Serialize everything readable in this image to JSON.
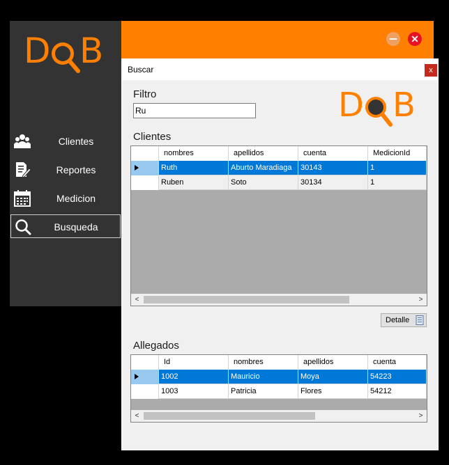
{
  "app": {
    "logo_text_left": "D",
    "logo_text_right": "B",
    "accent_color": "#ff8000",
    "sidebar": {
      "items": [
        {
          "label": "Clientes",
          "icon": "users-icon"
        },
        {
          "label": "Reportes",
          "icon": "report-edit-icon"
        },
        {
          "label": "Medicion",
          "icon": "calendar-icon"
        },
        {
          "label": "Busqueda",
          "icon": "search-icon",
          "active": true
        }
      ]
    },
    "window_controls": {
      "minimize": "minimize-icon",
      "close": "close-icon"
    }
  },
  "dialog": {
    "title": "Buscar",
    "close_label": "x",
    "filter_label": "Filtro",
    "filter_value": "Ru",
    "clientes_label": "Clientes",
    "clientes_grid": {
      "columns": [
        "nombres",
        "apellidos",
        "cuenta",
        "MedicionId"
      ],
      "rows": [
        [
          "Ruth",
          "Aburto Maradiaga",
          "30143",
          "1"
        ],
        [
          "Ruben",
          "Soto",
          "30134",
          "1"
        ]
      ],
      "selected_row": 0
    },
    "detalle_button": "Detalle",
    "allegados_label": "Allegados",
    "allegados_grid": {
      "columns": [
        "Id",
        "nombres",
        "apellidos",
        "cuenta"
      ],
      "rows": [
        [
          "1002",
          "Mauricio",
          "Moya",
          "54223"
        ],
        [
          "1003",
          "Patricia",
          "Flores",
          "54212"
        ]
      ],
      "selected_row": 0
    },
    "scroll_left": "<",
    "scroll_right": ">"
  }
}
